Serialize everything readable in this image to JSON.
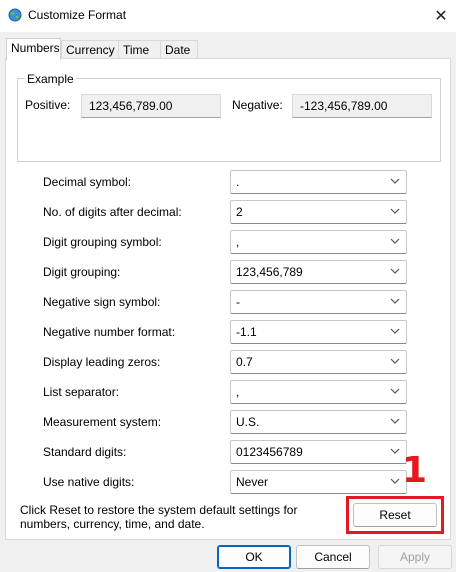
{
  "window": {
    "title": "Customize Format",
    "close_glyph": "✕",
    "icon": "globe-icon"
  },
  "tabs": [
    {
      "label": "Numbers",
      "active": true
    },
    {
      "label": "Currency",
      "active": false
    },
    {
      "label": "Time",
      "active": false
    },
    {
      "label": "Date",
      "active": false
    }
  ],
  "example": {
    "legend": "Example",
    "positive_label": "Positive:",
    "positive_value": "123,456,789.00",
    "negative_label": "Negative:",
    "negative_value": "-123,456,789.00"
  },
  "settings": [
    {
      "label": "Decimal symbol:",
      "value": "."
    },
    {
      "label": "No. of digits after decimal:",
      "value": "2"
    },
    {
      "label": "Digit grouping symbol:",
      "value": ","
    },
    {
      "label": "Digit grouping:",
      "value": "123,456,789"
    },
    {
      "label": "Negative sign symbol:",
      "value": "-"
    },
    {
      "label": "Negative number format:",
      "value": "-1.1"
    },
    {
      "label": "Display leading zeros:",
      "value": "0.7"
    },
    {
      "label": "List separator:",
      "value": ","
    },
    {
      "label": "Measurement system:",
      "value": "U.S."
    },
    {
      "label": "Standard digits:",
      "value": "0123456789"
    },
    {
      "label": "Use native digits:",
      "value": "Never"
    }
  ],
  "footer": {
    "text": "Click Reset to restore the system default settings for numbers, currency, time, and date.",
    "reset_label": "Reset",
    "annotation_number": "1",
    "annotation_color": "#e3191f"
  },
  "buttons": {
    "ok": "OK",
    "cancel": "Cancel",
    "apply": "Apply"
  },
  "colors": {
    "primary_border": "#0067c0",
    "panel_bg": "#ffffff",
    "window_bg": "#f0f0f0"
  }
}
